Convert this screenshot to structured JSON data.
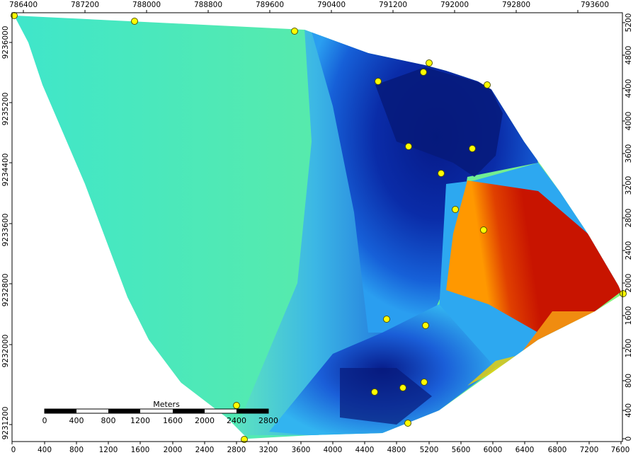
{
  "map": {
    "top_axis_labels": [
      "786400",
      "787200",
      "788000",
      "788800",
      "789600",
      "790400",
      "791200",
      "792000",
      "792800",
      "793600"
    ],
    "bottom_axis_labels": [
      "0",
      "400",
      "800",
      "1200",
      "1600",
      "2000",
      "2400",
      "2800",
      "3200",
      "3600",
      "4000",
      "4400",
      "4800",
      "5200",
      "5600",
      "6000",
      "6400",
      "6800",
      "7200",
      "7600"
    ],
    "left_axis_labels": [
      "9236000",
      "9235200",
      "9234400",
      "9233600",
      "9232800",
      "9232000",
      "9231200"
    ],
    "right_axis_labels": [
      "5200",
      "4800",
      "4400",
      "4000",
      "3600",
      "3200",
      "2800",
      "2400",
      "2000",
      "1600",
      "1200",
      "800",
      "400",
      "0"
    ],
    "scale_bar": {
      "title": "Meters",
      "labels": [
        "0",
        "400",
        "800",
        "1200",
        "1600",
        "2000",
        "2400",
        "2800"
      ]
    },
    "colors": {
      "point_fill": "#ffff00",
      "point_stroke": "#555500",
      "dark_blue": "#0a1e8c",
      "red": "#c81400",
      "turquoise": "#3ee6c8",
      "light_green": "#8cf278"
    }
  }
}
